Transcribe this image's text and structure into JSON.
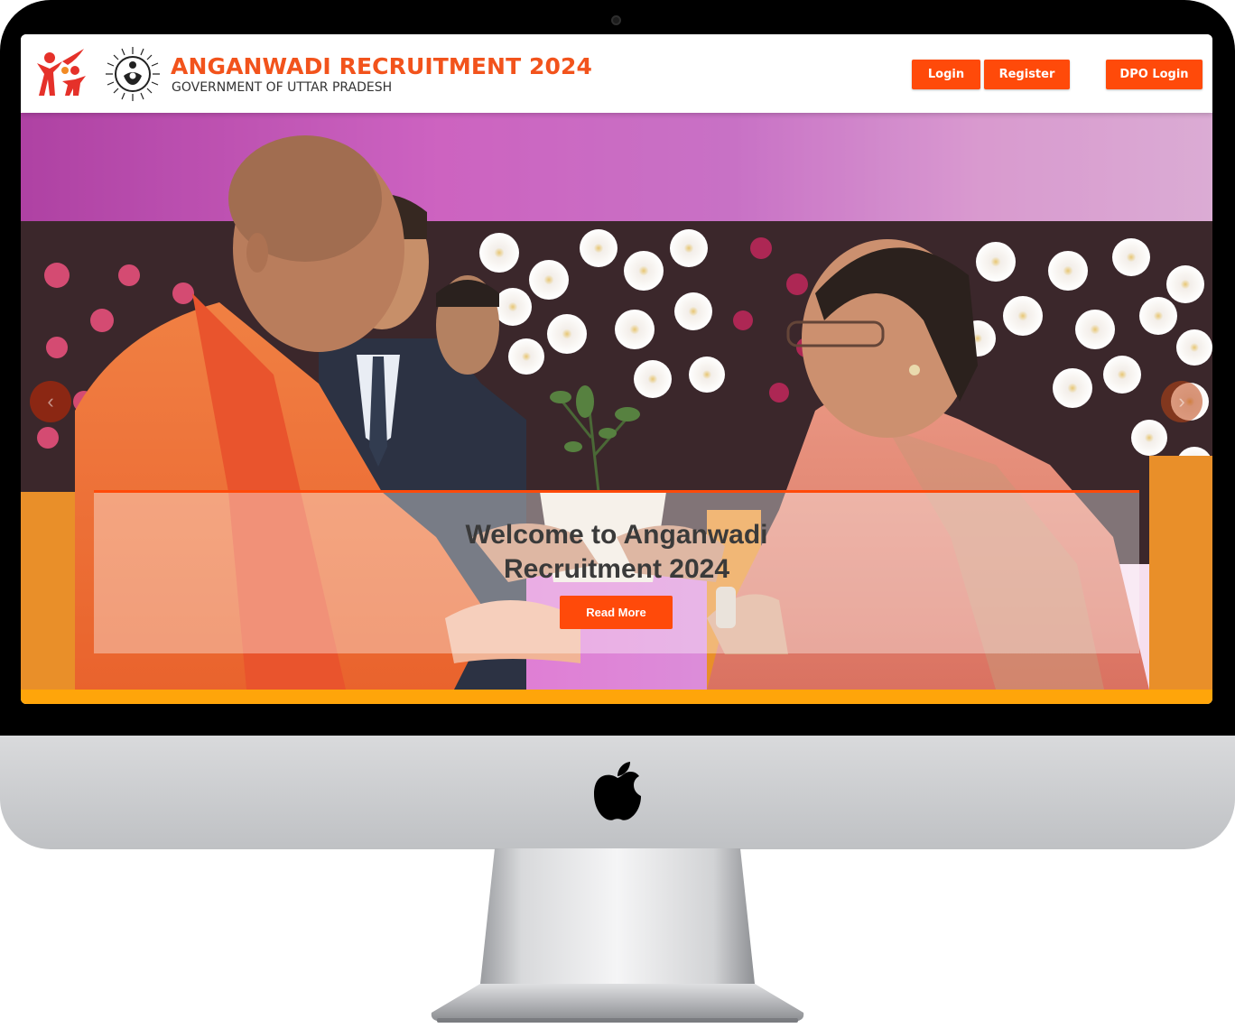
{
  "header": {
    "title": "ANGANWADI RECRUITMENT 2024",
    "subtitle": "GOVERNMENT OF UTTAR PRADESH",
    "buttons": {
      "login": "Login",
      "register": "Register",
      "dpo_login": "DPO Login"
    }
  },
  "hero": {
    "caption_line1": "Welcome to Anganwadi",
    "caption_line2": "Recruitment 2024",
    "read_more": "Read More",
    "prev_arrow": "‹",
    "next_arrow": "›"
  },
  "icons": {
    "kids_logo": "anganwadi-kids-logo",
    "emblem": "icds-emblem",
    "apple": "apple-logo"
  },
  "colors": {
    "accent": "#ff4a0a",
    "title": "#f2531c",
    "strip": "#ffa50a"
  }
}
